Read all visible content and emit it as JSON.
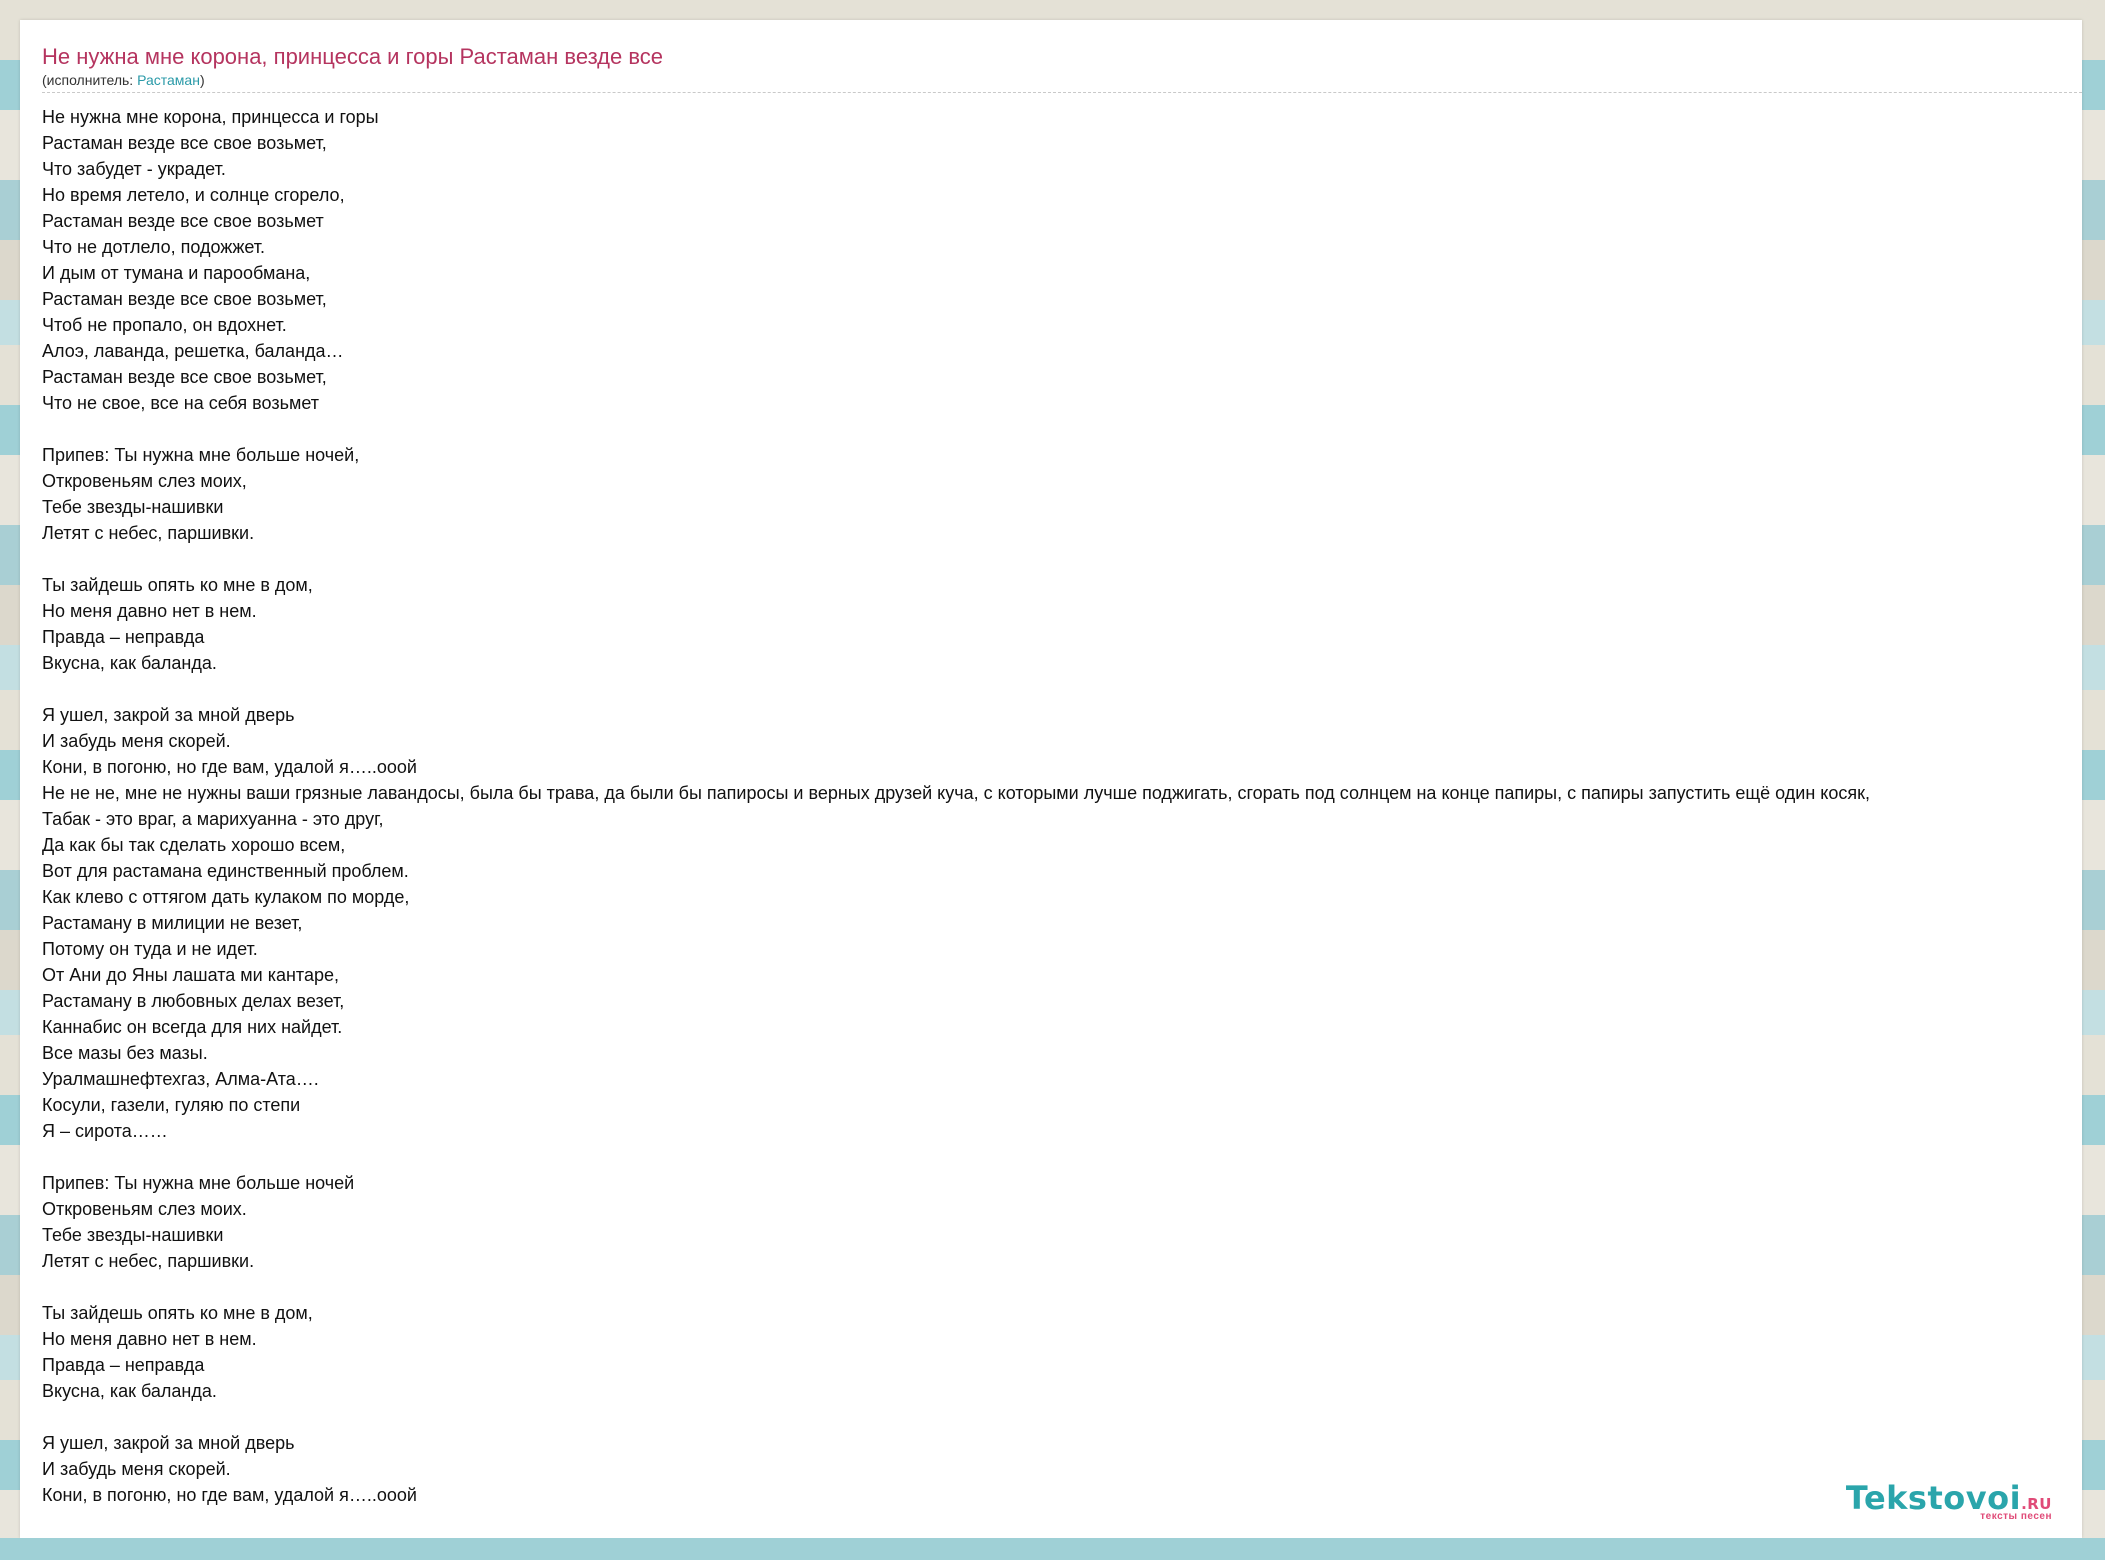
{
  "song": {
    "title": "Не нужна мне корона, принцесса и горы Растаман везде все",
    "performer_prefix": "(исполнитель: ",
    "performer_name": "Растаман",
    "performer_suffix": ")"
  },
  "lyrics": [
    "Не нужна мне корона, принцесса и горы",
    "Растаман везде все свое возьмет,",
    "Что забудет - украдет.",
    "Но время летело, и солнце сгорело,",
    "Растаман везде все свое возьмет",
    "Что не дотлело, подожжет.",
    "И дым от тумана и парообмана,",
    "Растаман везде все свое возьмет,",
    "Чтоб не пропало, он вдохнет.",
    "Алоэ, лаванда, решетка, баланда…",
    "Растаман везде все свое возьмет,",
    "Что не свое, все на себя возьмет",
    "",
    "Припев: Ты нужна мне больше ночей,",
    "Откровеньям слез моих,",
    "Тебе звезды-нашивки",
    "Летят с небес, паршивки.",
    "",
    "Ты зайдешь опять ко мне в дом,",
    "Но меня давно нет в нем.",
    "Правда – неправда",
    "Вкусна, как баланда.",
    "",
    "Я ушел, закрой за мной дверь",
    "И забудь меня скорей.",
    "Кони, в погоню, но где вам, удалой я…..ооой",
    "Не не не, мне не нужны ваши грязные лавандосы, была бы трава, да были бы папиросы и верных друзей куча, с которыми лучше поджигать, сгорать под солнцем на конце папиры, с папиры запустить ещё один косяк,",
    "Табак - это враг, а марихуанна - это друг,",
    "Да как бы так сделать хорошо всем,",
    "Вот для растамана единственный проблем.",
    "Как клево с оттягом дать кулаком по морде,",
    "Растаману в милиции не везет,",
    "Потому он туда и не идет.",
    "От Ани до Яны лашата ми кантаре,",
    "Растаману в любовных делах везет,",
    "Каннабис он всегда для них найдет.",
    "Все мазы без мазы.",
    "Уралмашнефтехгаз, Алма-Ата….",
    "Косули, газели, гуляю по степи",
    "Я – сирота……",
    "",
    "Припев: Ты нужна мне больше ночей",
    "Откровеньям слез моих.",
    "Тебе звезды-нашивки",
    "Летят с небес, паршивки.",
    "",
    "Ты зайдешь опять ко мне в дом,",
    "Но меня давно нет в нем.",
    "Правда – неправда",
    "Вкусна, как баланда.",
    "",
    "Я ушел, закрой за мной дверь",
    "И забудь меня скорей.",
    "Кони, в погоню, но где вам, удалой я…..ооой"
  ],
  "logo": {
    "brand": "Tekstovoi",
    "tld": ".RU",
    "tagline": "тексты песен"
  },
  "colors": {
    "title": "#b5345f",
    "link": "#2a9aa8",
    "brand": "#2aa5ab",
    "accent": "#e04b78"
  }
}
